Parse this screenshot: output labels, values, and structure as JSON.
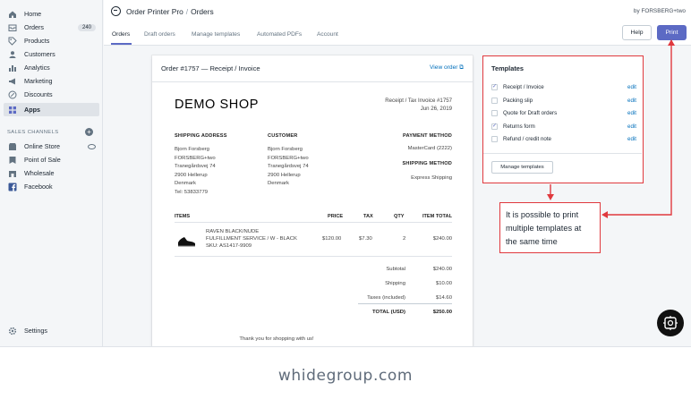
{
  "sidebar": {
    "items": [
      {
        "label": "Home",
        "icon": "home-icon"
      },
      {
        "label": "Orders",
        "icon": "orders-icon",
        "badge": "240"
      },
      {
        "label": "Products",
        "icon": "tag-icon"
      },
      {
        "label": "Customers",
        "icon": "person-icon"
      },
      {
        "label": "Analytics",
        "icon": "bar-chart-icon"
      },
      {
        "label": "Marketing",
        "icon": "megaphone-icon"
      },
      {
        "label": "Discounts",
        "icon": "discount-icon"
      },
      {
        "label": "Apps",
        "icon": "apps-icon",
        "active": true
      }
    ],
    "channels_title": "SALES CHANNELS",
    "channels": [
      {
        "label": "Online Store",
        "icon": "store-icon"
      },
      {
        "label": "Point of Sale",
        "icon": "pos-icon"
      },
      {
        "label": "Wholesale",
        "icon": "wholesale-icon"
      },
      {
        "label": "Facebook",
        "icon": "facebook-icon"
      }
    ],
    "settings_label": "Settings"
  },
  "header": {
    "app_name": "Order Printer Pro",
    "separator": "/",
    "page": "Orders",
    "byline": "by FORSBERG+two"
  },
  "tabs": [
    {
      "label": "Orders",
      "active": true
    },
    {
      "label": "Draft orders"
    },
    {
      "label": "Manage templates"
    },
    {
      "label": "Automated PDFs"
    },
    {
      "label": "Account"
    }
  ],
  "buttons": {
    "help": "Help",
    "print": "Print"
  },
  "invoice": {
    "title": "Order #1757 — Receipt / Invoice",
    "view_order": "View order",
    "shop_name": "DEMO SHOP",
    "invoice_no": "Receipt / Tax Invoice #1757",
    "date": "Jun 26, 2019",
    "shipping_address_h": "SHIPPING ADDRESS",
    "customer_h": "CUSTOMER",
    "payment_method_h": "PAYMENT METHOD",
    "shipping_method_h": "SHIPPING METHOD",
    "shipping_address": [
      "Bjorn Forsberg",
      "FORSBERG+two",
      "Tranegårdsvej 74",
      "2900 Hellerup",
      "Denmark",
      "Tel: 53833779"
    ],
    "customer": [
      "Bjorn Forsberg",
      "FORSBERG+two",
      "Tranegårdsvej 74",
      "2900 Hellerup",
      "Denmark"
    ],
    "payment_method": "MasterCard (2222)",
    "shipping_method": "Express Shipping",
    "item_headers": {
      "items": "ITEMS",
      "price": "PRICE",
      "tax": "TAX",
      "qty": "QTY",
      "total": "ITEM TOTAL"
    },
    "item": {
      "lines": [
        "RAVEN BLACK/NUDE",
        "FULFILLMENT SERVICE / W - BLACK",
        "SKU: AS1417-9909"
      ],
      "price": "$120.00",
      "tax": "$7.30",
      "qty": "2",
      "total": "$240.00"
    },
    "totals": [
      {
        "label": "Subtotal",
        "value": "$240.00"
      },
      {
        "label": "Shipping",
        "value": "$10.00"
      },
      {
        "label": "Taxes (included)",
        "value": "$14.60"
      },
      {
        "label": "TOTAL (USD)",
        "value": "$250.00"
      }
    ],
    "thanks": "Thank you for shopping with us!"
  },
  "templates": {
    "title": "Templates",
    "items": [
      {
        "label": "Receipt / Invoice",
        "checked": true,
        "edit": "edit"
      },
      {
        "label": "Packing slip",
        "checked": false,
        "edit": "edit"
      },
      {
        "label": "Quote for Draft orders",
        "checked": false,
        "edit": "edit"
      },
      {
        "label": "Returns form",
        "checked": true,
        "edit": "edit"
      },
      {
        "label": "Refund / credit note",
        "checked": false,
        "edit": "edit"
      }
    ],
    "manage_button": "Manage templates"
  },
  "callout": "It is possible to print multiple templates at the same time",
  "footer": "whidegroup.com",
  "colors": {
    "accent": "#5c6ac4",
    "annotation": "#e0393e",
    "link": "#006fbb"
  }
}
